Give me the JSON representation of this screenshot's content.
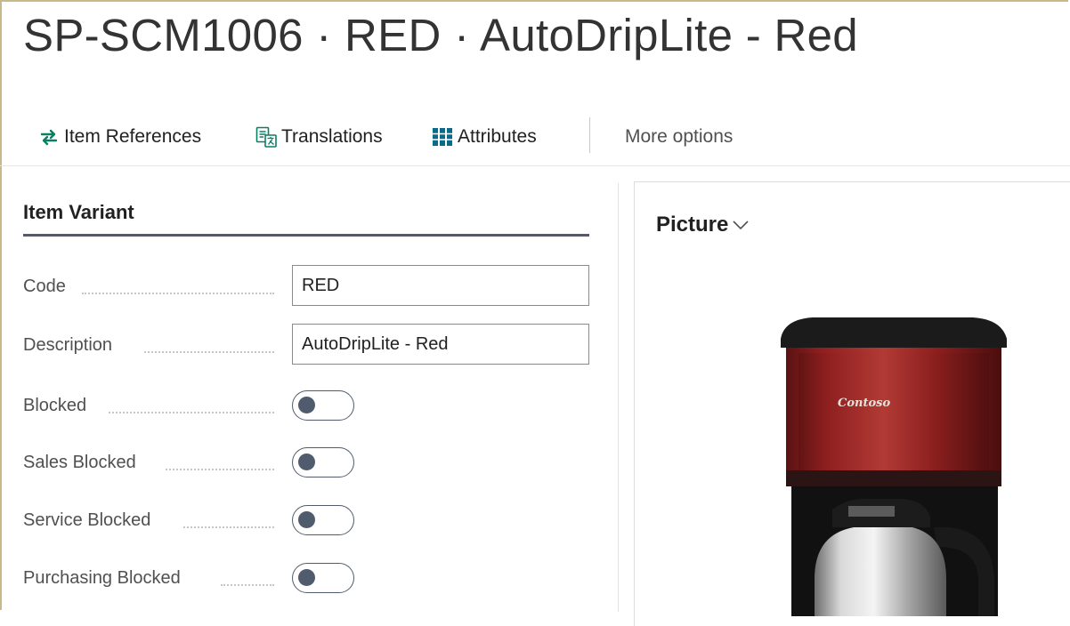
{
  "page": {
    "title": "SP-SCM1006 · RED · AutoDripLite - Red"
  },
  "actions": {
    "item_references": "Item References",
    "translations": "Translations",
    "attributes": "Attributes",
    "more_options": "More options"
  },
  "icons": {
    "item_references": "arrows-swap-icon",
    "translations": "translate-icon",
    "attributes": "grid-columns-icon",
    "picture_toggle": "chevron-down-icon"
  },
  "colors": {
    "accent": "#0b7f64",
    "attributes_icon": "#0a6a8a",
    "section_underline": "#505c6d",
    "toggle": "#505c6d"
  },
  "item_variant": {
    "title": "Item Variant",
    "fields": {
      "code": {
        "label": "Code",
        "value": "RED"
      },
      "description": {
        "label": "Description",
        "value": "AutoDripLite - Red"
      },
      "blocked": {
        "label": "Blocked",
        "value": false
      },
      "sales_blocked": {
        "label": "Sales Blocked",
        "value": false
      },
      "service_blocked": {
        "label": "Service Blocked",
        "value": false
      },
      "purchasing_blocked": {
        "label": "Purchasing Blocked",
        "value": false
      }
    }
  },
  "picture": {
    "title": "Picture",
    "brand_text": "Contoso"
  }
}
